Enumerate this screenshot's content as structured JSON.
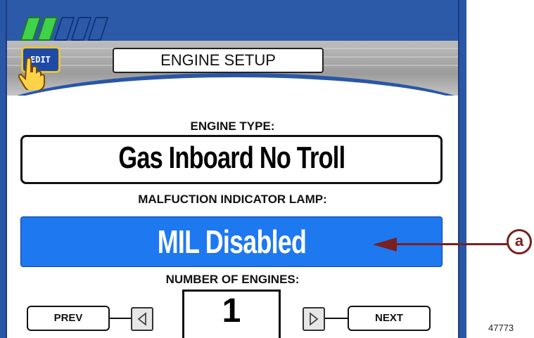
{
  "header": {
    "signal_bars": [
      true,
      true,
      false,
      false,
      false
    ],
    "edit_label": "EDIT",
    "title": "ENGINE SETUP"
  },
  "engine_type": {
    "label": "ENGINE TYPE:",
    "value": "Gas Inboard No Troll"
  },
  "mil": {
    "label": "MALFUCTION INDICATOR LAMP:",
    "value": "MIL Disabled"
  },
  "engines": {
    "label": "NUMBER OF ENGINES:",
    "value": "1"
  },
  "nav": {
    "prev_label": "PREV",
    "next_label": "NEXT"
  },
  "callout": {
    "letter": "a"
  },
  "figure_number": "47773",
  "colors": {
    "frame_blue": "#2a56a6",
    "selected_blue": "#1e78f0",
    "bar_on": "#3fd24a",
    "callout": "#7a1f1f",
    "edit_border": "#e8c13a"
  },
  "icons": [
    "pointing-hand-icon",
    "left-triangle-icon",
    "right-triangle-icon"
  ]
}
